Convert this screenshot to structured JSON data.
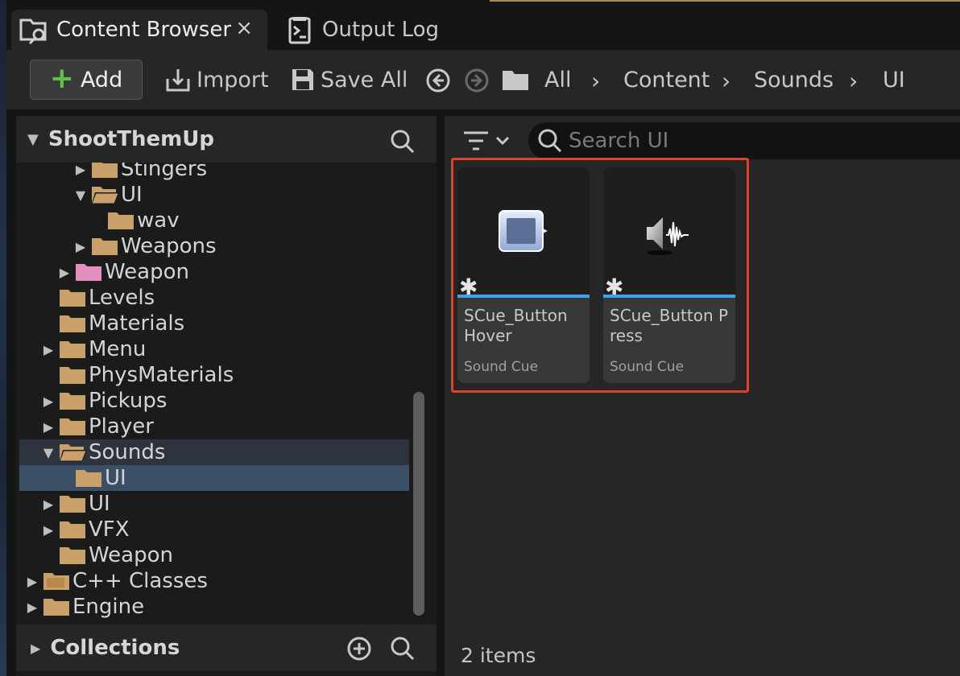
{
  "tabs": {
    "content_browser": "Content Browser",
    "close_glyph": "×",
    "output_log": "Output Log"
  },
  "toolbar": {
    "add_label": "Add",
    "import_label": "Import",
    "save_all_label": "Save All",
    "breadcrumb": [
      "All",
      "Content",
      "Sounds",
      "UI"
    ]
  },
  "left_panel": {
    "project_name": "ShootThemUp",
    "tree": [
      {
        "label": "Stingers",
        "expandable": true,
        "expanded": false,
        "folder": "closed"
      },
      {
        "label": "UI",
        "expandable": true,
        "expanded": true,
        "folder": "open"
      },
      {
        "label": "wav",
        "expandable": false,
        "folder": "closed"
      },
      {
        "label": "Weapons",
        "expandable": true,
        "expanded": false,
        "folder": "closed"
      },
      {
        "label": "Weapon",
        "expandable": true,
        "expanded": false,
        "folder": "pink"
      },
      {
        "label": "Levels",
        "expandable": false,
        "folder": "closed"
      },
      {
        "label": "Materials",
        "expandable": false,
        "folder": "closed"
      },
      {
        "label": "Menu",
        "expandable": true,
        "expanded": false,
        "folder": "closed"
      },
      {
        "label": "PhysMaterials",
        "expandable": false,
        "folder": "closed"
      },
      {
        "label": "Pickups",
        "expandable": true,
        "expanded": false,
        "folder": "closed"
      },
      {
        "label": "Player",
        "expandable": true,
        "expanded": false,
        "folder": "closed"
      },
      {
        "label": "Sounds",
        "expandable": true,
        "expanded": true,
        "folder": "open",
        "highlight": "parent"
      },
      {
        "label": "UI",
        "expandable": false,
        "folder": "closed",
        "highlight": "selected"
      },
      {
        "label": "UI",
        "expandable": true,
        "expanded": false,
        "folder": "closed"
      },
      {
        "label": "VFX",
        "expandable": true,
        "expanded": false,
        "folder": "closed"
      },
      {
        "label": "Weapon",
        "expandable": false,
        "folder": "closed"
      },
      {
        "label": "C++ Classes",
        "expandable": true,
        "expanded": false,
        "folder": "cpp"
      },
      {
        "label": "Engine",
        "expandable": true,
        "expanded": false,
        "folder": "closed"
      }
    ],
    "collections_label": "Collections"
  },
  "right_panel": {
    "search_placeholder": "Search UI",
    "assets": [
      {
        "name": "SCue_Button Hover",
        "type": "Sound Cue",
        "thumb": "button-icon"
      },
      {
        "name": "SCue_Button Press",
        "type": "Sound Cue",
        "thumb": "speaker-icon"
      }
    ],
    "star_glyph": "✱",
    "item_count": "2 items"
  },
  "colors": {
    "accent_blue": "#3fa3ea",
    "selection_red": "#d8442c",
    "folder_tan": "#c9a06a",
    "folder_pink": "#e58fc0",
    "add_green": "#5fc246",
    "tree_selected": "#3b4f66",
    "tree_parent": "#2d3440"
  }
}
